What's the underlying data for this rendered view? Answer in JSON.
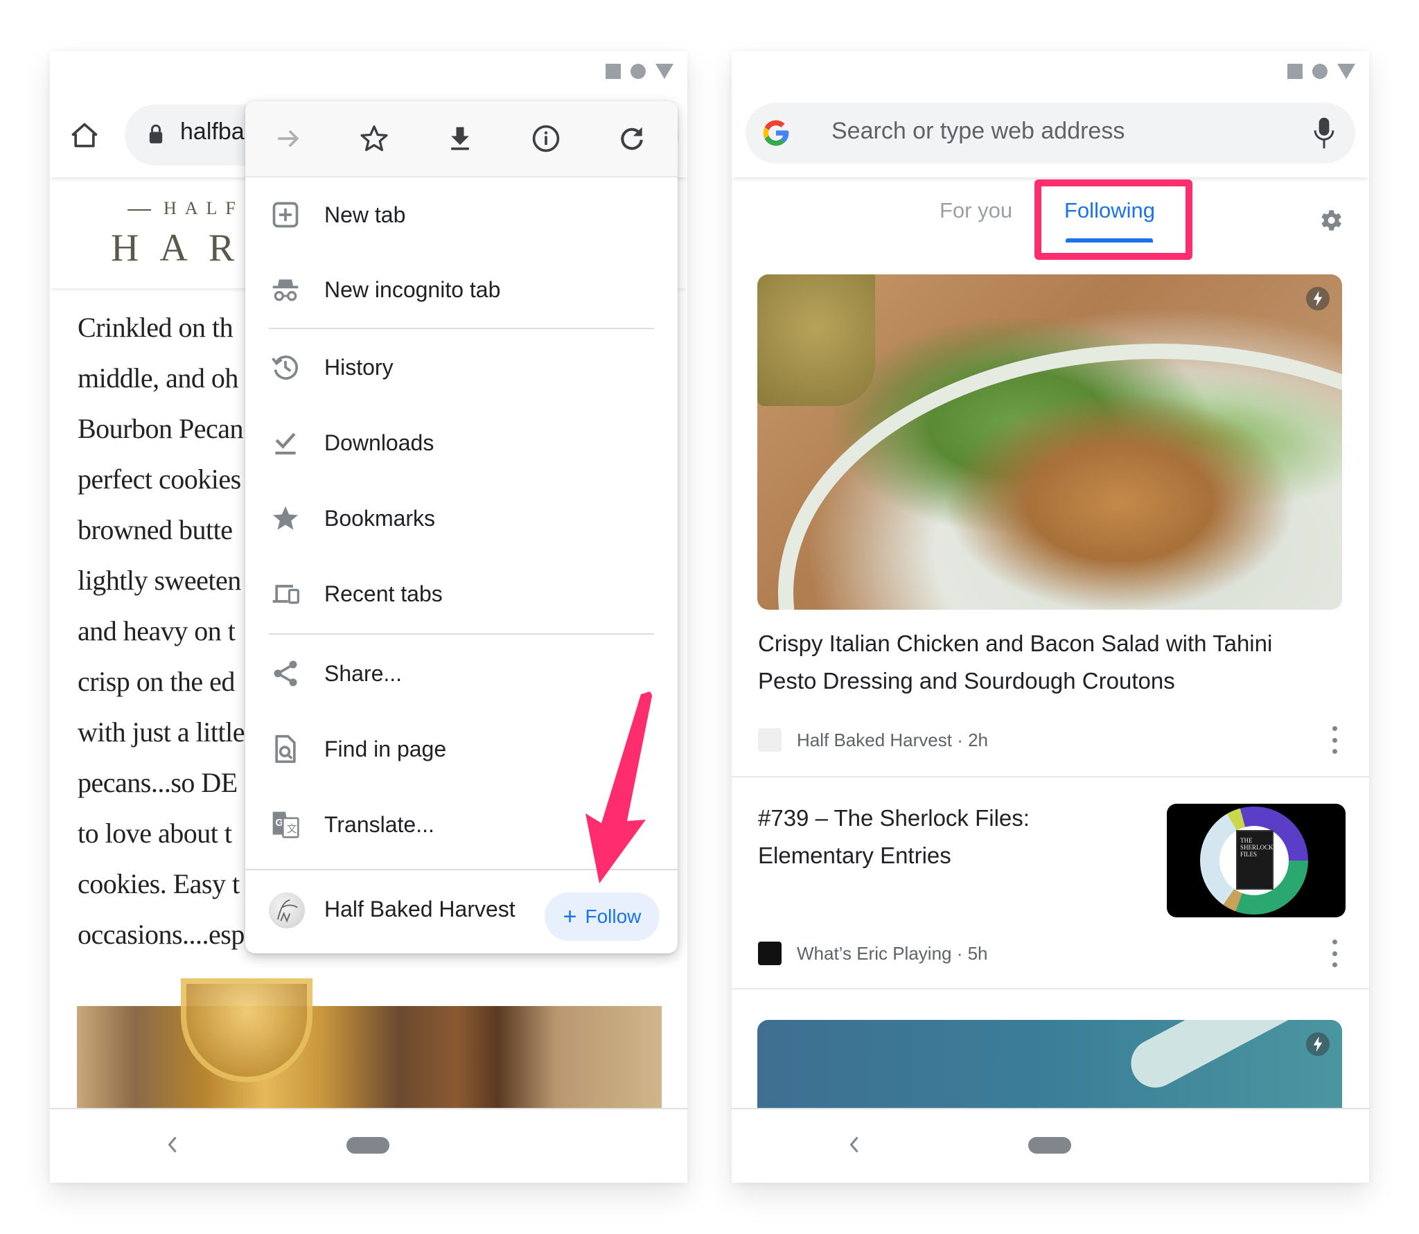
{
  "left_phone": {
    "toolbar": {
      "url_text": "halfba",
      "home_icon": "home-icon",
      "lock_icon": "lock-icon"
    },
    "article": {
      "logo_small": "HALF",
      "logo_big": "HAR",
      "lines": [
        "Crinkled on th",
        "middle, and oh",
        "Bourbon Pecan",
        "perfect cookies",
        "browned butte",
        "lightly sweeten",
        "and heavy on t",
        "crisp on the ed",
        "with just a little",
        "pecans...so DE",
        "to love about t",
        "cookies. Easy t",
        "occasions....esp"
      ]
    },
    "menu": {
      "icon_row": [
        {
          "icon": "forward-icon",
          "label": "Forward"
        },
        {
          "icon": "star-outline-icon",
          "label": "Bookmark"
        },
        {
          "icon": "download-icon",
          "label": "Download"
        },
        {
          "icon": "info-icon",
          "label": "Page info"
        },
        {
          "icon": "refresh-icon",
          "label": "Refresh"
        }
      ],
      "items": [
        {
          "label": "New tab",
          "icon": "new-tab-icon"
        },
        {
          "label": "New incognito tab",
          "icon": "incognito-icon"
        },
        {
          "label": "History",
          "icon": "history-icon"
        },
        {
          "label": "Downloads",
          "icon": "downloads-icon"
        },
        {
          "label": "Bookmarks",
          "icon": "bookmarks-icon"
        },
        {
          "label": "Recent tabs",
          "icon": "recent-tabs-icon"
        },
        {
          "label": "Share...",
          "icon": "share-icon"
        },
        {
          "label": "Find in page",
          "icon": "find-in-page-icon"
        },
        {
          "label": "Translate...",
          "icon": "translate-icon"
        }
      ],
      "follow_row": {
        "site_name": "Half Baked Harvest",
        "button_plus": "+",
        "button_label": "Follow"
      }
    }
  },
  "right_phone": {
    "search": {
      "placeholder": "Search or type web address"
    },
    "tabs": [
      {
        "label": "For you",
        "active": false
      },
      {
        "label": "Following",
        "active": true
      }
    ],
    "cards": [
      {
        "title": "Crispy Italian Chicken and Bacon Salad with Tahini Pesto Dressing and Sourdough Croutons",
        "source": "Half Baked Harvest · 2h"
      },
      {
        "title": "#739 – The Sherlock Files: Elementary Entries",
        "source": "What’s Eric Playing · 5h",
        "thumb_text": "THE SHERLOCK FILES"
      }
    ]
  },
  "colors": {
    "accent_blue": "#1a73e8",
    "annotation_pink": "#ff2d6e",
    "follow_bg": "#e8f0fe",
    "omnibox_bg": "#f1f3f4"
  }
}
